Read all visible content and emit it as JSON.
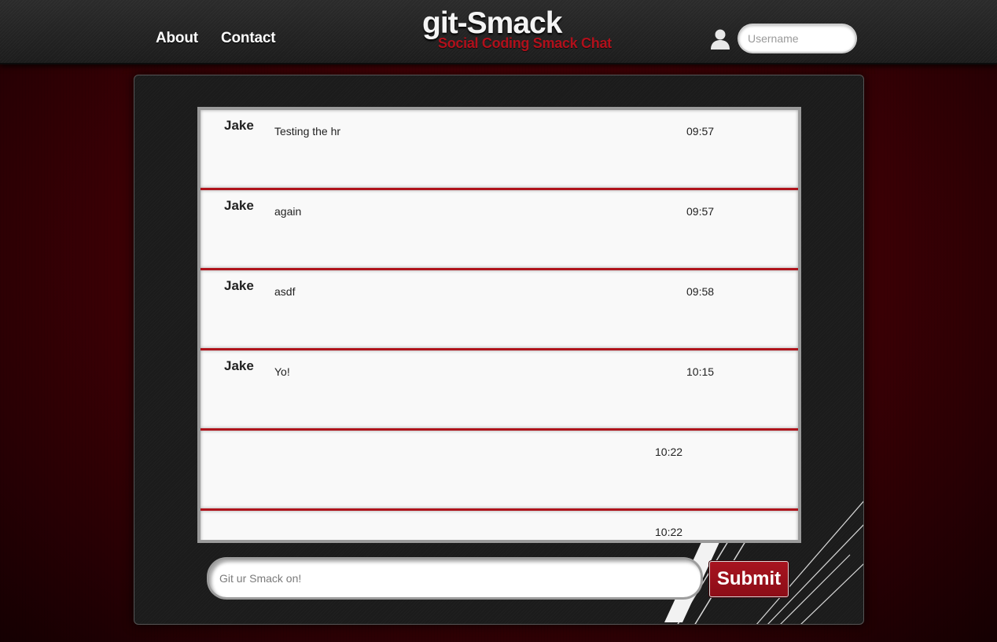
{
  "header": {
    "nav": [
      {
        "label": "About"
      },
      {
        "label": "Contact"
      }
    ],
    "logo_title": "git-Smack",
    "logo_subtitle": "Social Coding Smack Chat",
    "username_placeholder": "Username",
    "user_icon": "user-icon"
  },
  "chat": {
    "messages": [
      {
        "user": "Jake",
        "text": "Testing the hr",
        "time": "09:57"
      },
      {
        "user": "Jake",
        "text": "again",
        "time": "09:57"
      },
      {
        "user": "Jake",
        "text": "asdf",
        "time": "09:58"
      },
      {
        "user": "Jake",
        "text": "Yo!",
        "time": "10:15"
      },
      {
        "user": "",
        "text": "",
        "time": "10:22"
      },
      {
        "user": "",
        "text": "",
        "time": "10:22"
      }
    ],
    "input_placeholder": "Git ur Smack on!",
    "submit_label": "Submit"
  },
  "colors": {
    "accent": "#b0101b",
    "background_red": "#4a0006",
    "panel": "#1b1b1b"
  }
}
